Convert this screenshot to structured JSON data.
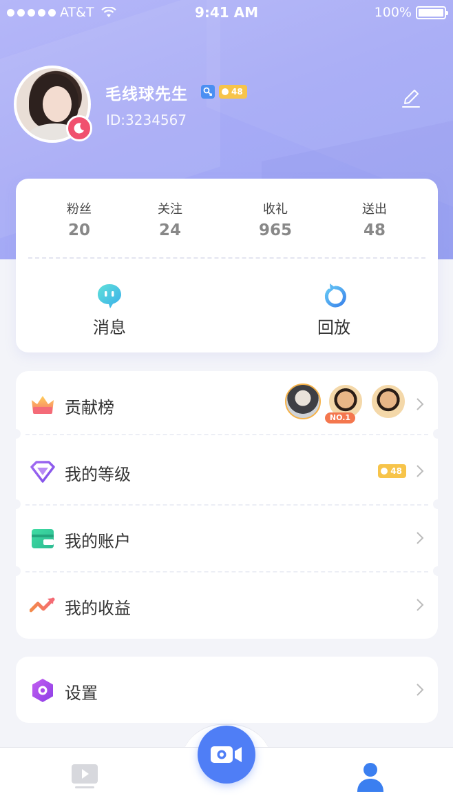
{
  "status_bar": {
    "carrier": "AT&T",
    "time": "9:41 AM",
    "battery": "100%"
  },
  "profile": {
    "username": "毛线球先生",
    "level": "48",
    "user_id": "ID:3234567"
  },
  "stats": [
    {
      "label": "粉丝",
      "value": "20"
    },
    {
      "label": "关注",
      "value": "24"
    },
    {
      "label": "收礼",
      "value": "965"
    },
    {
      "label": "送出",
      "value": "48"
    }
  ],
  "actions": {
    "messages": "消息",
    "replay": "回放"
  },
  "menu": {
    "contribution": {
      "label": "贡献榜",
      "rank_badge": "NO.1"
    },
    "my_level": {
      "label": "我的等级",
      "level": "48"
    },
    "my_account": {
      "label": "我的账户"
    },
    "my_earnings": {
      "label": "我的收益"
    },
    "settings": {
      "label": "设置"
    }
  },
  "colors": {
    "header_gradient_start": "#b5b7f8",
    "header_gradient_end": "#9ca5f3",
    "accent_blue": "#4f7ef6",
    "level_badge": "#f7c44a",
    "moon_badge": "#f0506e"
  },
  "icons": {
    "edit": "pencil-icon",
    "messages": "chat-bubble-icon",
    "replay": "replay-icon",
    "contribution": "crown-icon",
    "level": "diamond-icon",
    "account": "wallet-icon",
    "earnings": "trend-icon",
    "settings": "hexagon-gear-icon",
    "tab_video": "play-tv-icon",
    "tab_record": "camera-icon",
    "tab_profile": "person-icon"
  }
}
